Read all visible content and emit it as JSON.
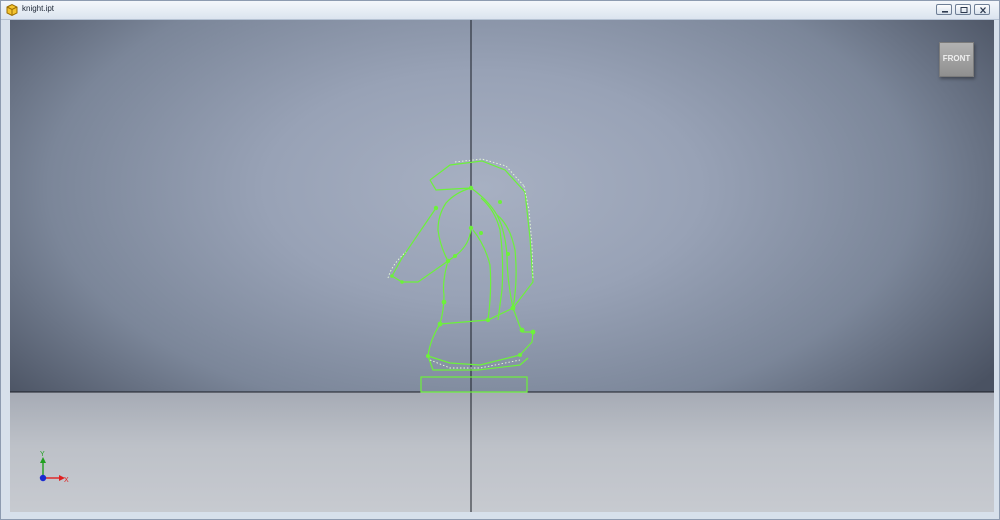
{
  "window": {
    "title": "knight.ipt",
    "file_icon": "part-file-icon",
    "controls": [
      "minimize-icon",
      "restore-icon",
      "close-icon"
    ]
  },
  "viewcube": {
    "face_label": "FRONT"
  },
  "triad": {
    "x_label": "X",
    "y_label": "Y",
    "x_color": "#e02020",
    "y_color": "#20a020",
    "origin_color": "#1a2bd0"
  },
  "colors": {
    "sketch_line": "#6cf23a",
    "axis_line": "#1a1e26"
  }
}
